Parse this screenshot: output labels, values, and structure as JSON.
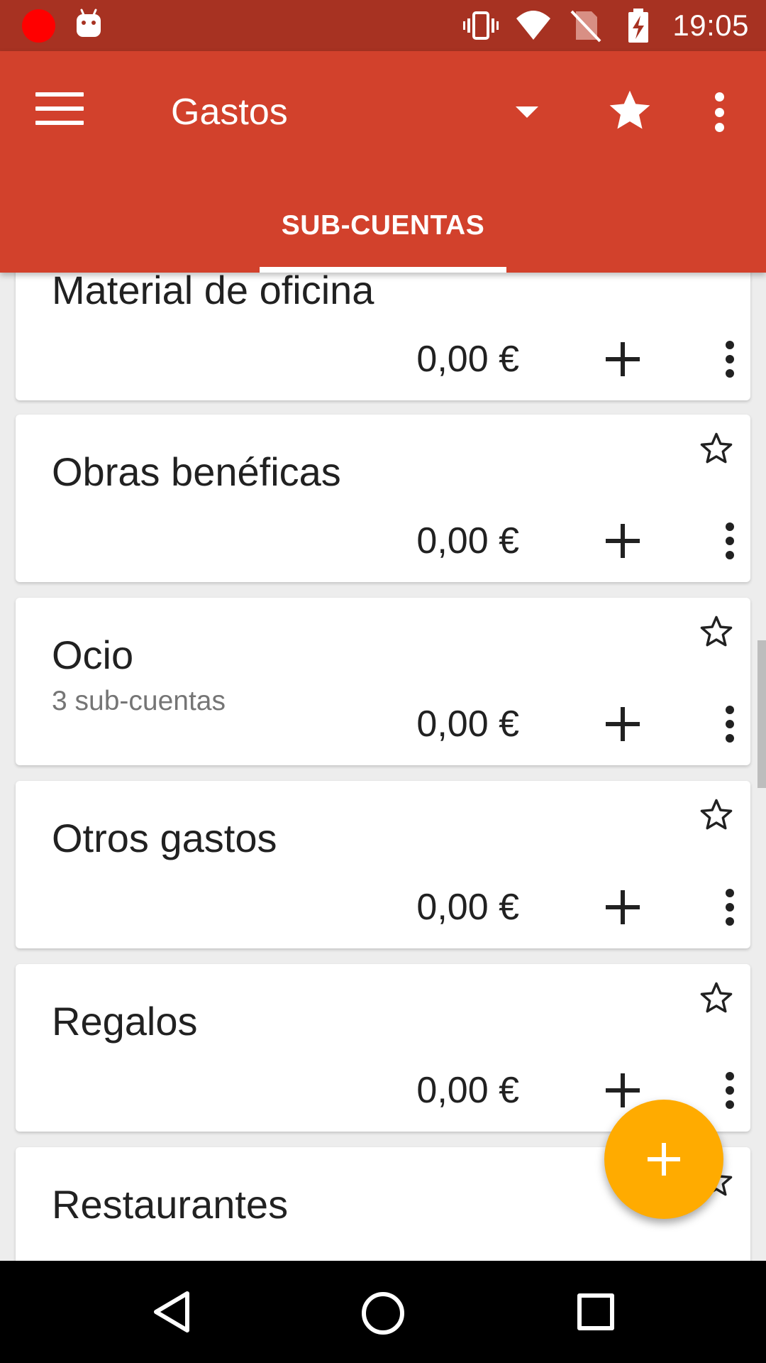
{
  "status_bar": {
    "time": "19:05",
    "icons": [
      "record-icon",
      "android-icon",
      "vibrate-icon",
      "wifi-icon",
      "no-sim-icon",
      "battery-charging-icon"
    ]
  },
  "app_bar": {
    "title": "Gastos",
    "tab_label": "SUB-CUENTAS"
  },
  "colors": {
    "primary": "#d2412c",
    "status_bar": "#a73222",
    "accent": "#ffab00"
  },
  "accounts": [
    {
      "name": "Material de oficina",
      "subtitle": "",
      "amount": "0,00 €"
    },
    {
      "name": "Obras benéficas",
      "subtitle": "",
      "amount": "0,00 €"
    },
    {
      "name": "Ocio",
      "subtitle": "3 sub-cuentas",
      "amount": "0,00 €"
    },
    {
      "name": "Otros gastos",
      "subtitle": "",
      "amount": "0,00 €"
    },
    {
      "name": "Regalos",
      "subtitle": "",
      "amount": "0,00 €"
    },
    {
      "name": "Restaurantes",
      "subtitle": "",
      "amount": ""
    }
  ]
}
